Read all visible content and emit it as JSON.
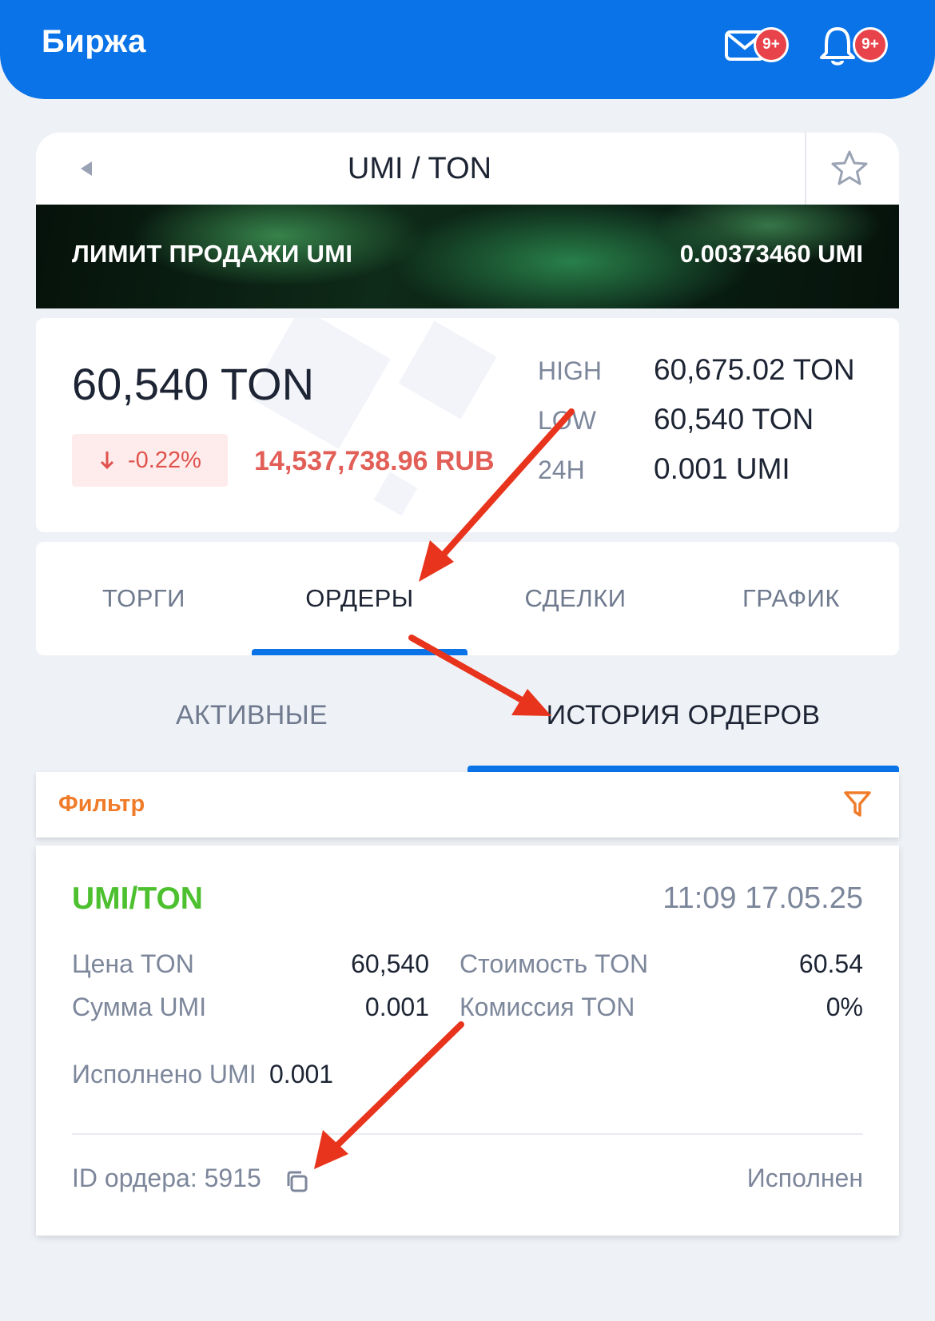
{
  "header": {
    "title": "Биржа",
    "mail_badge": "9+",
    "bell_badge": "9+",
    "accent_color": "#0a73e8"
  },
  "pair": {
    "title": "UMI / TON"
  },
  "banner": {
    "label": "ЛИМИТ ПРОДАЖИ UMI",
    "value": "0.00373460 UMI"
  },
  "ticker": {
    "last_price": "60,540 TON",
    "change": "-0.22%",
    "fiat_value": "14,537,738.96 RUB",
    "stats": [
      {
        "label": "HIGH",
        "value": "60,675.02 TON"
      },
      {
        "label": "LOW",
        "value": "60,540 TON"
      },
      {
        "label": "24H",
        "value": "0.001 UMI"
      }
    ]
  },
  "tabs": [
    "ТОРГИ",
    "ОРДЕРЫ",
    "СДЕЛКИ",
    "ГРАФИК"
  ],
  "active_tab": "ОРДЕРЫ",
  "subtabs": [
    "АКТИВНЫЕ",
    "ИСТОРИЯ ОРДЕРОВ"
  ],
  "active_subtab": "ИСТОРИЯ ОРДЕРОВ",
  "filter": {
    "label": "Фильтр",
    "color": "#f07c2a"
  },
  "order": {
    "pair": "UMI/TON",
    "time": "11:09 17.05.25",
    "price_label": "Цена TON",
    "price_value": "60,540",
    "amount_label": "Сумма UMI",
    "amount_value": "0.001",
    "cost_label": "Стоимость TON",
    "cost_value": "60.54",
    "fee_label": "Комиссия TON",
    "fee_value": "0%",
    "filled_label": "Исполнено UMI",
    "filled_value": "0.001",
    "id_text": "ID ордера: 5915",
    "status": "Исполнен",
    "pair_color": "#4cc02e"
  },
  "annotation_arrow_color": "#e8341c"
}
